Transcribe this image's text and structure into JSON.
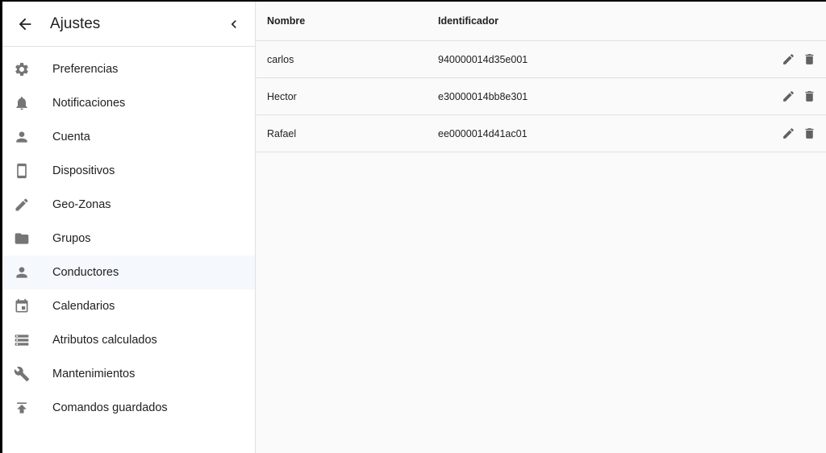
{
  "sidebar": {
    "title": "Ajustes",
    "items": [
      {
        "label": "Preferencias",
        "icon": "gear-icon"
      },
      {
        "label": "Notificaciones",
        "icon": "bell-icon"
      },
      {
        "label": "Cuenta",
        "icon": "person-icon"
      },
      {
        "label": "Dispositivos",
        "icon": "smartphone-icon"
      },
      {
        "label": "Geo-Zonas",
        "icon": "pencil-icon"
      },
      {
        "label": "Grupos",
        "icon": "folder-icon"
      },
      {
        "label": "Conductores",
        "icon": "person-icon",
        "active": true
      },
      {
        "label": "Calendarios",
        "icon": "calendar-icon"
      },
      {
        "label": "Atributos calculados",
        "icon": "storage-icon"
      },
      {
        "label": "Mantenimientos",
        "icon": "wrench-icon"
      },
      {
        "label": "Comandos guardados",
        "icon": "publish-icon"
      }
    ]
  },
  "table": {
    "headers": {
      "name": "Nombre",
      "identifier": "Identificador"
    },
    "rows": [
      {
        "name": "carlos",
        "identifier": "940000014d35e001"
      },
      {
        "name": "Hector",
        "identifier": "e30000014bb8e301"
      },
      {
        "name": "Rafael",
        "identifier": "ee0000014d41ac01"
      }
    ]
  },
  "colors": {
    "active_bg": "#f5f8fd",
    "icon_gray": "#757575",
    "border": "#e0e0e0"
  }
}
